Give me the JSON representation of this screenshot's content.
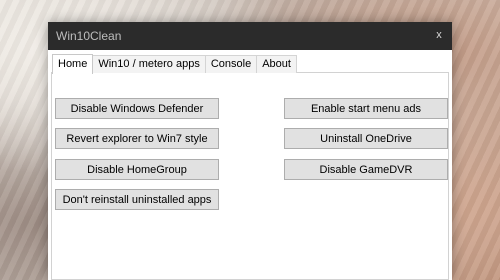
{
  "window": {
    "title": "Win10Clean",
    "close_glyph": "x"
  },
  "tabs": [
    {
      "label": "Home",
      "active": true
    },
    {
      "label": "Win10 / metero apps",
      "active": false
    },
    {
      "label": "Console",
      "active": false
    },
    {
      "label": "About",
      "active": false
    }
  ],
  "home": {
    "left_buttons": [
      "Disable Windows Defender",
      "Revert explorer to Win7 style",
      "Disable HomeGroup",
      "Don't reinstall uninstalled apps"
    ],
    "right_buttons": [
      "Enable start menu ads",
      "Uninstall OneDrive",
      "Disable GameDVR"
    ]
  },
  "colors": {
    "titlebar_bg": "#2b2b2b",
    "button_bg": "#e1e1e1",
    "button_border": "#adadad"
  }
}
